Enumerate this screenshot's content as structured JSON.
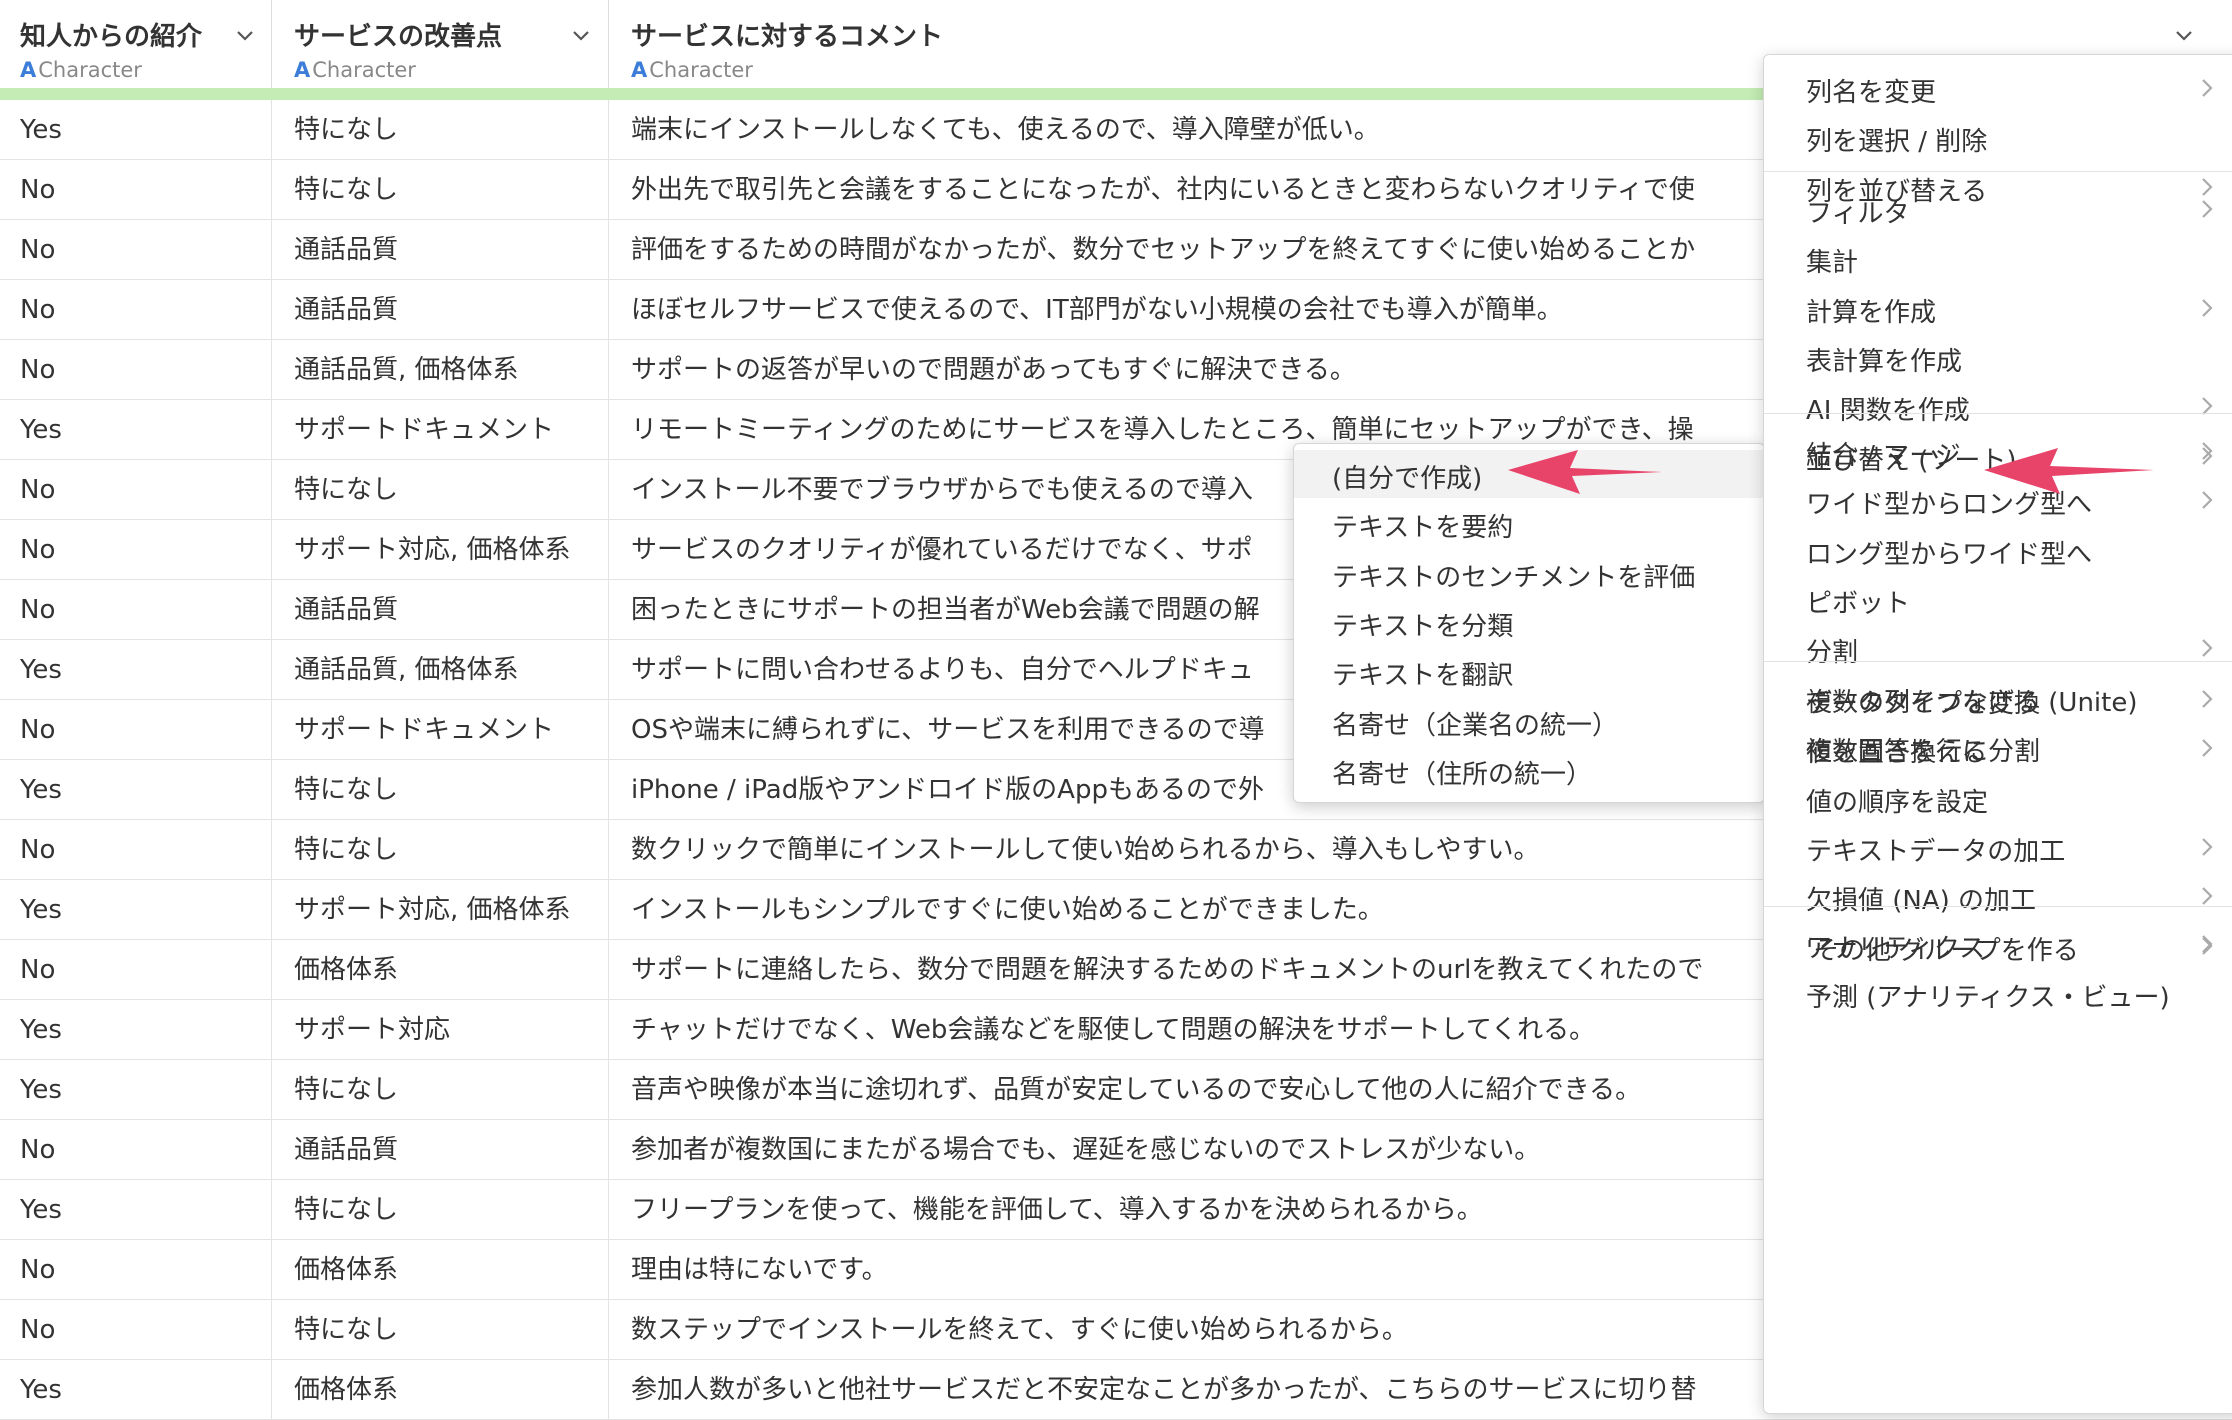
{
  "columns": [
    {
      "name": "知人からの紹介",
      "type": "Character"
    },
    {
      "name": "サービスの改善点",
      "type": "Character"
    },
    {
      "name": "サービスに対するコメント",
      "type": "Character"
    }
  ],
  "type_glyph": "A",
  "rows": [
    [
      "Yes",
      "特になし",
      "端末にインストールしなくても、使えるので、導入障壁が低い。"
    ],
    [
      "No",
      "特になし",
      "外出先で取引先と会議をすることになったが、社内にいるときと変わらないクオリティで使"
    ],
    [
      "No",
      "通話品質",
      "評価をするための時間がなかったが、数分でセットアップを終えてすぐに使い始めることか"
    ],
    [
      "No",
      "通話品質",
      "ほぼセルフサービスで使えるので、IT部門がない小規模の会社でも導入が簡単。"
    ],
    [
      "No",
      "通話品質, 価格体系",
      "サポートの返答が早いので問題があってもすぐに解決できる。"
    ],
    [
      "Yes",
      "サポートドキュメント",
      "リモートミーティングのためにサービスを導入したところ、簡単にセットアップができ、操"
    ],
    [
      "No",
      "特になし",
      "インストール不要でブラウザからでも使えるので導入"
    ],
    [
      "No",
      "サポート対応, 価格体系",
      "サービスのクオリティが優れているだけでなく、サポ"
    ],
    [
      "No",
      "通話品質",
      "困ったときにサポートの担当者がWeb会議で問題の解"
    ],
    [
      "Yes",
      "通話品質, 価格体系",
      "サポートに問い合わせるよりも、自分でヘルプドキュ"
    ],
    [
      "No",
      "サポートドキュメント",
      "OSや端末に縛られずに、サービスを利用できるので導"
    ],
    [
      "Yes",
      "特になし",
      "iPhone / iPad版やアンドロイド版のAppもあるので外"
    ],
    [
      "No",
      "特になし",
      "数クリックで簡単にインストールして使い始められるから、導入もしやすい。"
    ],
    [
      "Yes",
      "サポート対応, 価格体系",
      "インストールもシンプルですぐに使い始めることができました。"
    ],
    [
      "No",
      "価格体系",
      "サポートに連絡したら、数分で問題を解決するためのドキュメントのurlを教えてくれたので"
    ],
    [
      "Yes",
      "サポート対応",
      "チャットだけでなく、Web会議などを駆使して問題の解決をサポートしてくれる。"
    ],
    [
      "Yes",
      "特になし",
      "音声や映像が本当に途切れず、品質が安定しているので安心して他の人に紹介できる。"
    ],
    [
      "No",
      "通話品質",
      "参加者が複数国にまたがる場合でも、遅延を感じないのでストレスが少ない。"
    ],
    [
      "Yes",
      "特になし",
      "フリープランを使って、機能を評価して、導入するかを決められるから。"
    ],
    [
      "No",
      "価格体系",
      "理由は特にないです。"
    ],
    [
      "No",
      "特になし",
      "数ステップでインストールを終えて、すぐに使い始められるから。"
    ],
    [
      "Yes",
      "価格体系",
      "参加人数が多いと他社サービスだと不安定なことが多かったが、こちらのサービスに切り替"
    ]
  ],
  "menu": {
    "groups": [
      [
        {
          "label": "列名を変更",
          "submenu": true
        },
        {
          "label": "列を選択 / 削除",
          "submenu": false
        },
        {
          "label": "列を並び替える",
          "submenu": true
        }
      ],
      [
        {
          "label": "フィルタ",
          "submenu": true
        },
        {
          "label": "集計",
          "submenu": false
        },
        {
          "label": "計算を作成",
          "submenu": true
        },
        {
          "label": "表計算を作成",
          "submenu": false
        },
        {
          "label": "AI 関数を作成",
          "submenu": true
        },
        {
          "label": "並び替え (ソート)",
          "submenu": true
        }
      ],
      [
        {
          "label": "結合 / マージ",
          "submenu": true
        },
        {
          "label": "ワイド型からロング型へ",
          "submenu": true
        },
        {
          "label": "ロング型からワイド型へ",
          "submenu": false
        },
        {
          "label": "ピボット",
          "submenu": false
        },
        {
          "label": "分割",
          "submenu": true
        },
        {
          "label": "複数の列をつなげる (Unite)",
          "submenu": false
        },
        {
          "label": "複数回答を行に分割",
          "submenu": false
        }
      ],
      [
        {
          "label": "データタイプを変換",
          "submenu": true
        },
        {
          "label": "値を置き換える",
          "submenu": true
        },
        {
          "label": "値の順序を設定",
          "submenu": false
        },
        {
          "label": "テキストデータの加工",
          "submenu": true
        },
        {
          "label": "欠損値 (NA) の加工",
          "submenu": true
        },
        {
          "label": "'その他'グループを作る",
          "submenu": true
        }
      ],
      [
        {
          "label": "アナリティクス",
          "submenu": true
        },
        {
          "label": "予測 (アナリティクス・ビュー)",
          "submenu": false
        }
      ]
    ]
  },
  "submenu": {
    "items": [
      "(自分で作成)",
      "テキストを要約",
      "テキストのセンチメントを評価",
      "テキストを分類",
      "テキストを翻訳",
      "名寄せ（企業名の統一）",
      "名寄せ（住所の統一）"
    ],
    "active_index": 0
  },
  "colors": {
    "type_icon": "#3b7dd8",
    "quality_bar": "#c4ecb4",
    "annotation_arrow": "#e8446a"
  }
}
